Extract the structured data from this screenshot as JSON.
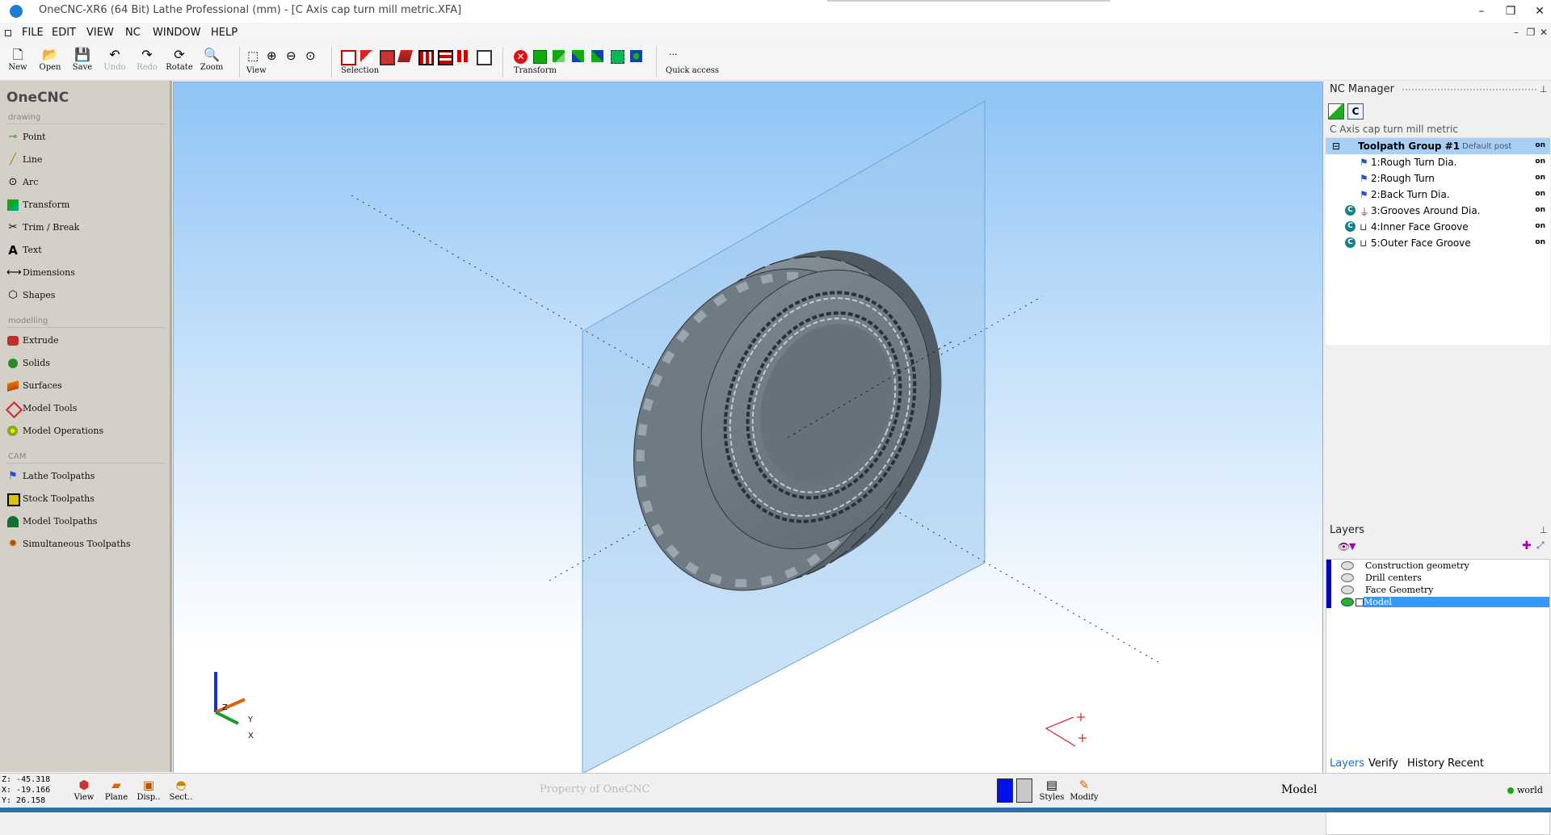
{
  "window": {
    "title": "OneCNC-XR6 (64 Bit) Lathe Professional (mm) - [C Axis cap turn mill metric.XFA]",
    "controls": [
      "–",
      "❐",
      "✕"
    ],
    "mdi_controls": [
      "–",
      "❐",
      "✕"
    ]
  },
  "menu": [
    "FILE",
    "EDIT",
    "VIEW",
    "NC",
    "WINDOW",
    "HELP"
  ],
  "toolbar": {
    "file_buttons": [
      {
        "label": "New",
        "icon": "new-file-icon"
      },
      {
        "label": "Open",
        "icon": "open-folder-icon"
      },
      {
        "label": "Save",
        "icon": "save-disk-icon"
      },
      {
        "label": "Undo",
        "icon": "undo-icon",
        "disabled": true
      },
      {
        "label": "Redo",
        "icon": "redo-icon",
        "disabled": true
      },
      {
        "label": "Rotate",
        "icon": "rotate-icon"
      },
      {
        "label": "Zoom",
        "icon": "zoom-icon"
      }
    ],
    "view_label": "View",
    "selection_label": "Selection",
    "transform_label": "Transform",
    "quick_access_label": "Quick access",
    "quick_access_dots": "..."
  },
  "left_panel": {
    "brand": "OneCNC",
    "sections": [
      {
        "title": "drawing",
        "items": [
          {
            "label": "Point",
            "icon": "point-icon",
            "color": "#2a8a2a"
          },
          {
            "label": "Line",
            "icon": "line-icon",
            "color": "#a08000"
          },
          {
            "label": "Arc",
            "icon": "arc-icon",
            "color": "#222222"
          },
          {
            "label": "Transform",
            "icon": "transform-icon",
            "color": "#1a9a3a"
          },
          {
            "label": "Trim / Break",
            "icon": "trim-icon",
            "color": "#333333"
          },
          {
            "label": "Text",
            "icon": "text-icon",
            "color": "#000000"
          },
          {
            "label": "Dimensions",
            "icon": "dimensions-icon",
            "color": "#555555"
          },
          {
            "label": "Shapes",
            "icon": "shapes-icon",
            "color": "#333333"
          }
        ]
      },
      {
        "title": "modelling",
        "items": [
          {
            "label": "Extrude",
            "icon": "extrude-icon",
            "color": "#c0302a"
          },
          {
            "label": "Solids",
            "icon": "solids-icon",
            "color": "#2a8a2a"
          },
          {
            "label": "Surfaces",
            "icon": "surfaces-icon",
            "color": "#d06010"
          },
          {
            "label": "Model Tools",
            "icon": "model-tools-icon",
            "color": "#c03030"
          },
          {
            "label": "Model Operations",
            "icon": "model-operations-icon",
            "color": "#8aa010"
          }
        ]
      },
      {
        "title": "CAM",
        "items": [
          {
            "label": "Lathe Toolpaths",
            "icon": "lathe-toolpaths-icon",
            "color": "#2255cc"
          },
          {
            "label": "Stock Toolpaths",
            "icon": "stock-toolpaths-icon",
            "color": "#c8b000"
          },
          {
            "label": "Model Toolpaths",
            "icon": "model-toolpaths-icon",
            "color": "#107030"
          },
          {
            "label": "Simultaneous Toolpaths",
            "icon": "simultaneous-toolpaths-icon",
            "color": "#b05000"
          }
        ]
      }
    ]
  },
  "nc_manager": {
    "title": "NC Manager",
    "pin": "⊥",
    "file_name": "C Axis cap turn mill metric",
    "group": {
      "name": "Toolpath Group #1",
      "post": "Default post",
      "state": "on",
      "expander": "⊟"
    },
    "ops": [
      {
        "name": "1:Rough Turn Dia.",
        "state": "on",
        "c_axis": false,
        "icon": "flag-icon"
      },
      {
        "name": "2:Rough Turn",
        "state": "on",
        "c_axis": false,
        "icon": "flag-icon"
      },
      {
        "name": "2:Back Turn Dia.",
        "state": "on",
        "c_axis": false,
        "icon": "flag-icon"
      },
      {
        "name": "3:Grooves Around Dia.",
        "state": "on",
        "c_axis": true,
        "icon": "drill-icon"
      },
      {
        "name": "4:Inner Face Groove",
        "state": "on",
        "c_axis": true,
        "icon": "groove-icon"
      },
      {
        "name": "5:Outer Face Groove",
        "state": "on",
        "c_axis": true,
        "icon": "groove-icon"
      }
    ],
    "c_badge": "C"
  },
  "layers": {
    "title": "Layers",
    "pin": "⊥",
    "items": [
      {
        "name": "Construction geometry",
        "active": false
      },
      {
        "name": "Drill centers",
        "active": false
      },
      {
        "name": "Face Geometry",
        "active": false
      },
      {
        "name": "Model",
        "active": true
      }
    ]
  },
  "right_tabs": [
    "Layers",
    "Verify",
    "History",
    "Recent"
  ],
  "status": {
    "coords": [
      "Z: -45.318",
      "X: -19.166",
      "Y: 26.158"
    ],
    "buttons": [
      {
        "label": "View",
        "icon": "view-cube-icon"
      },
      {
        "label": "Plane",
        "icon": "plane-icon"
      },
      {
        "label": "Disp..",
        "icon": "display-icon"
      },
      {
        "label": "Sect..",
        "icon": "section-icon"
      }
    ],
    "watermark": "Property of OneCNC",
    "styles_label": "Styles",
    "modify_label": "Modify",
    "mode": "Model",
    "world": "world"
  },
  "viewport": {
    "axis_labels": [
      "Z",
      "Y",
      "X"
    ]
  },
  "colors": {
    "accent": "#3399ff",
    "selected_row": "#3399ff",
    "panel_bg": "#d4d0c8",
    "part_gray": "#6e7b84"
  }
}
